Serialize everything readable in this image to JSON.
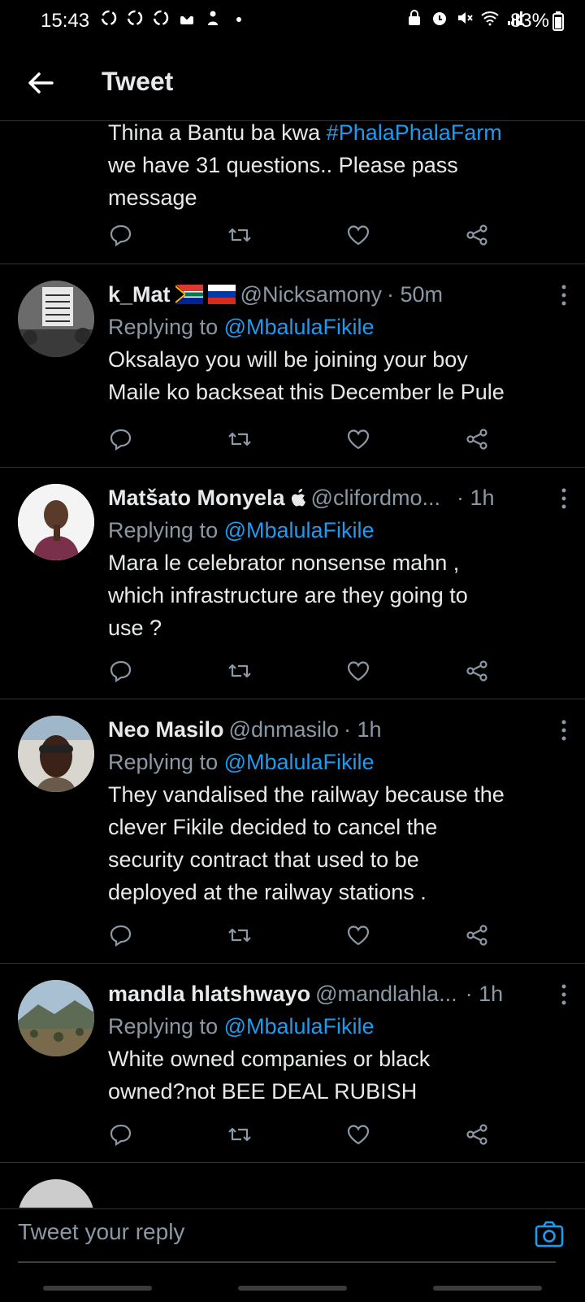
{
  "status_bar": {
    "time": "15:43",
    "battery": "83%"
  },
  "header": {
    "title": "Tweet",
    "back_icon": "arrow-left-icon"
  },
  "tweets": [
    {
      "text_parts": [
        "Thina a Bantu ba kwa ",
        "#PhalaPhalaFarm",
        "we have 31 questions.. Please pass",
        "message"
      ]
    },
    {
      "name": "k_Mat",
      "flags": [
        "south-africa-flag",
        "russia-flag"
      ],
      "handle": "@Nicksamony",
      "time": "· 50m",
      "replying_prefix": "Replying to ",
      "replying_to": "@MbalulaFikile",
      "lines": [
        "Oksalayo you will be joining your boy",
        "Maile ko backseat this December le Pule"
      ]
    },
    {
      "name": "Matšato Monyela",
      "badge": "",
      "handle": "@clifordmo...",
      "time": "· 1h",
      "replying_prefix": "Replying to ",
      "replying_to": "@MbalulaFikile",
      "lines": [
        "Mara le celebrator nonsense mahn ,",
        "which infrastructure are they going to",
        "use ?"
      ]
    },
    {
      "name": "Neo Masilo",
      "handle": "@dnmasilo",
      "time": "· 1h",
      "replying_prefix": "Replying to ",
      "replying_to": "@MbalulaFikile",
      "lines": [
        "They vandalised the railway because the",
        "clever Fikile decided to cancel the",
        "security contract that used to be",
        "deployed at the railway stations ."
      ]
    },
    {
      "name": "mandla hlatshwayo",
      "handle": "@mandlahla...",
      "time": "· 1h",
      "replying_prefix": "Replying to ",
      "replying_to": "@MbalulaFikile",
      "lines": [
        "White owned companies or black",
        "owned?not BEE DEAL RUBISH"
      ]
    }
  ],
  "reply_bar": {
    "placeholder": "Tweet your reply",
    "camera_icon": "camera-icon"
  },
  "colors": {
    "background": "#000000",
    "text": "#e7e9ea",
    "secondary": "#8b98a5",
    "accent": "#1d9bf0",
    "divider": "#2f3336"
  }
}
